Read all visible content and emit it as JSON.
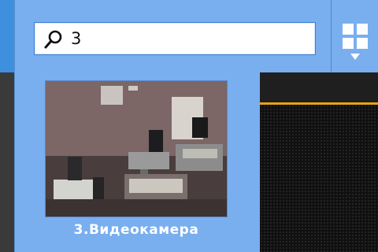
{
  "search": {
    "value": "3"
  },
  "cameras": [
    {
      "label": "3.Видеокамера"
    }
  ],
  "icons": {
    "search": "search-icon",
    "layout": "grid-icon",
    "dropdown": "chevron-down-icon"
  },
  "colors": {
    "panel": "#79aeef",
    "accent": "#e7a319",
    "viewer_bg": "#111111"
  }
}
